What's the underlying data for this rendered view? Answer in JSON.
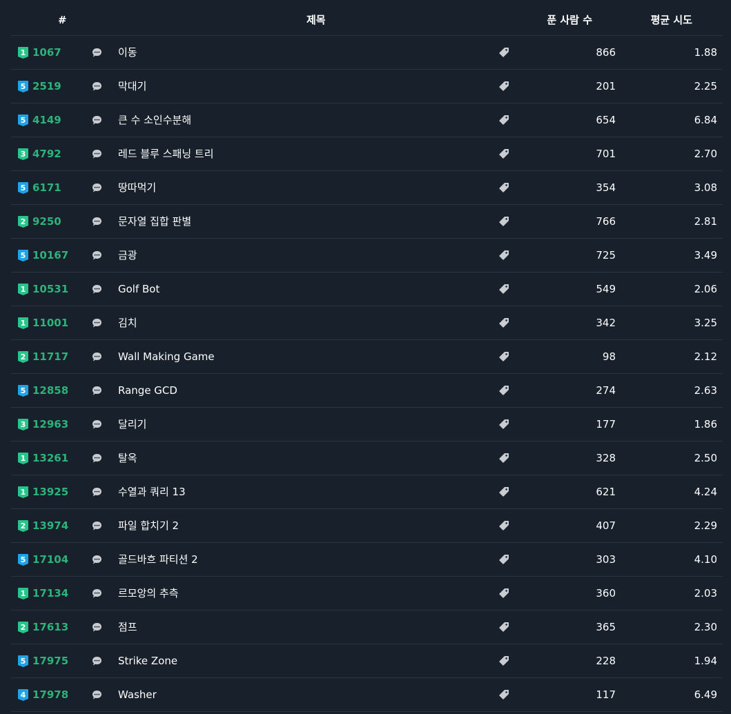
{
  "colors": {
    "background": "#17202b",
    "row_divider": "#2a3440",
    "problem_id": "#2db37a",
    "tier_silver_like_green": "#27c58a",
    "tier_blue": "#20a3e6",
    "icon_gray": "#c9cdd2"
  },
  "header": {
    "num": "#",
    "title": "제목",
    "solved": "푼 사람 수",
    "avg": "평균 시도"
  },
  "rows": [
    {
      "tier": "1",
      "tier_color": "green",
      "id": "1067",
      "title": "이동",
      "solved": "866",
      "avg": "1.88"
    },
    {
      "tier": "5",
      "tier_color": "blue",
      "id": "2519",
      "title": "막대기",
      "solved": "201",
      "avg": "2.25"
    },
    {
      "tier": "5",
      "tier_color": "blue",
      "id": "4149",
      "title": "큰 수 소인수분해",
      "solved": "654",
      "avg": "6.84"
    },
    {
      "tier": "3",
      "tier_color": "green",
      "id": "4792",
      "title": "레드 블루 스패닝 트리",
      "solved": "701",
      "avg": "2.70"
    },
    {
      "tier": "5",
      "tier_color": "blue",
      "id": "6171",
      "title": "땅따먹기",
      "solved": "354",
      "avg": "3.08"
    },
    {
      "tier": "2",
      "tier_color": "green",
      "id": "9250",
      "title": "문자열 집합 판별",
      "solved": "766",
      "avg": "2.81"
    },
    {
      "tier": "5",
      "tier_color": "blue",
      "id": "10167",
      "title": "금광",
      "solved": "725",
      "avg": "3.49"
    },
    {
      "tier": "1",
      "tier_color": "green",
      "id": "10531",
      "title": "Golf Bot",
      "solved": "549",
      "avg": "2.06"
    },
    {
      "tier": "1",
      "tier_color": "green",
      "id": "11001",
      "title": "김치",
      "solved": "342",
      "avg": "3.25"
    },
    {
      "tier": "2",
      "tier_color": "green",
      "id": "11717",
      "title": "Wall Making Game",
      "solved": "98",
      "avg": "2.12"
    },
    {
      "tier": "5",
      "tier_color": "blue",
      "id": "12858",
      "title": "Range GCD",
      "solved": "274",
      "avg": "2.63"
    },
    {
      "tier": "3",
      "tier_color": "green",
      "id": "12963",
      "title": "달리기",
      "solved": "177",
      "avg": "1.86"
    },
    {
      "tier": "1",
      "tier_color": "green",
      "id": "13261",
      "title": "탈옥",
      "solved": "328",
      "avg": "2.50"
    },
    {
      "tier": "1",
      "tier_color": "green",
      "id": "13925",
      "title": "수열과 쿼리 13",
      "solved": "621",
      "avg": "4.24"
    },
    {
      "tier": "2",
      "tier_color": "green",
      "id": "13974",
      "title": "파일 합치기 2",
      "solved": "407",
      "avg": "2.29"
    },
    {
      "tier": "5",
      "tier_color": "blue",
      "id": "17104",
      "title": "골드바흐 파티션 2",
      "solved": "303",
      "avg": "4.10"
    },
    {
      "tier": "1",
      "tier_color": "green",
      "id": "17134",
      "title": "르모앙의 추측",
      "solved": "360",
      "avg": "2.03"
    },
    {
      "tier": "2",
      "tier_color": "green",
      "id": "17613",
      "title": "점프",
      "solved": "365",
      "avg": "2.30"
    },
    {
      "tier": "5",
      "tier_color": "blue",
      "id": "17975",
      "title": "Strike Zone",
      "solved": "228",
      "avg": "1.94"
    },
    {
      "tier": "4",
      "tier_color": "blue",
      "id": "17978",
      "title": "Washer",
      "solved": "117",
      "avg": "6.49"
    }
  ],
  "icons": {
    "tier": "tier-badge-icon",
    "comment": "speech-bubble-icon",
    "tag": "tag-icon"
  }
}
